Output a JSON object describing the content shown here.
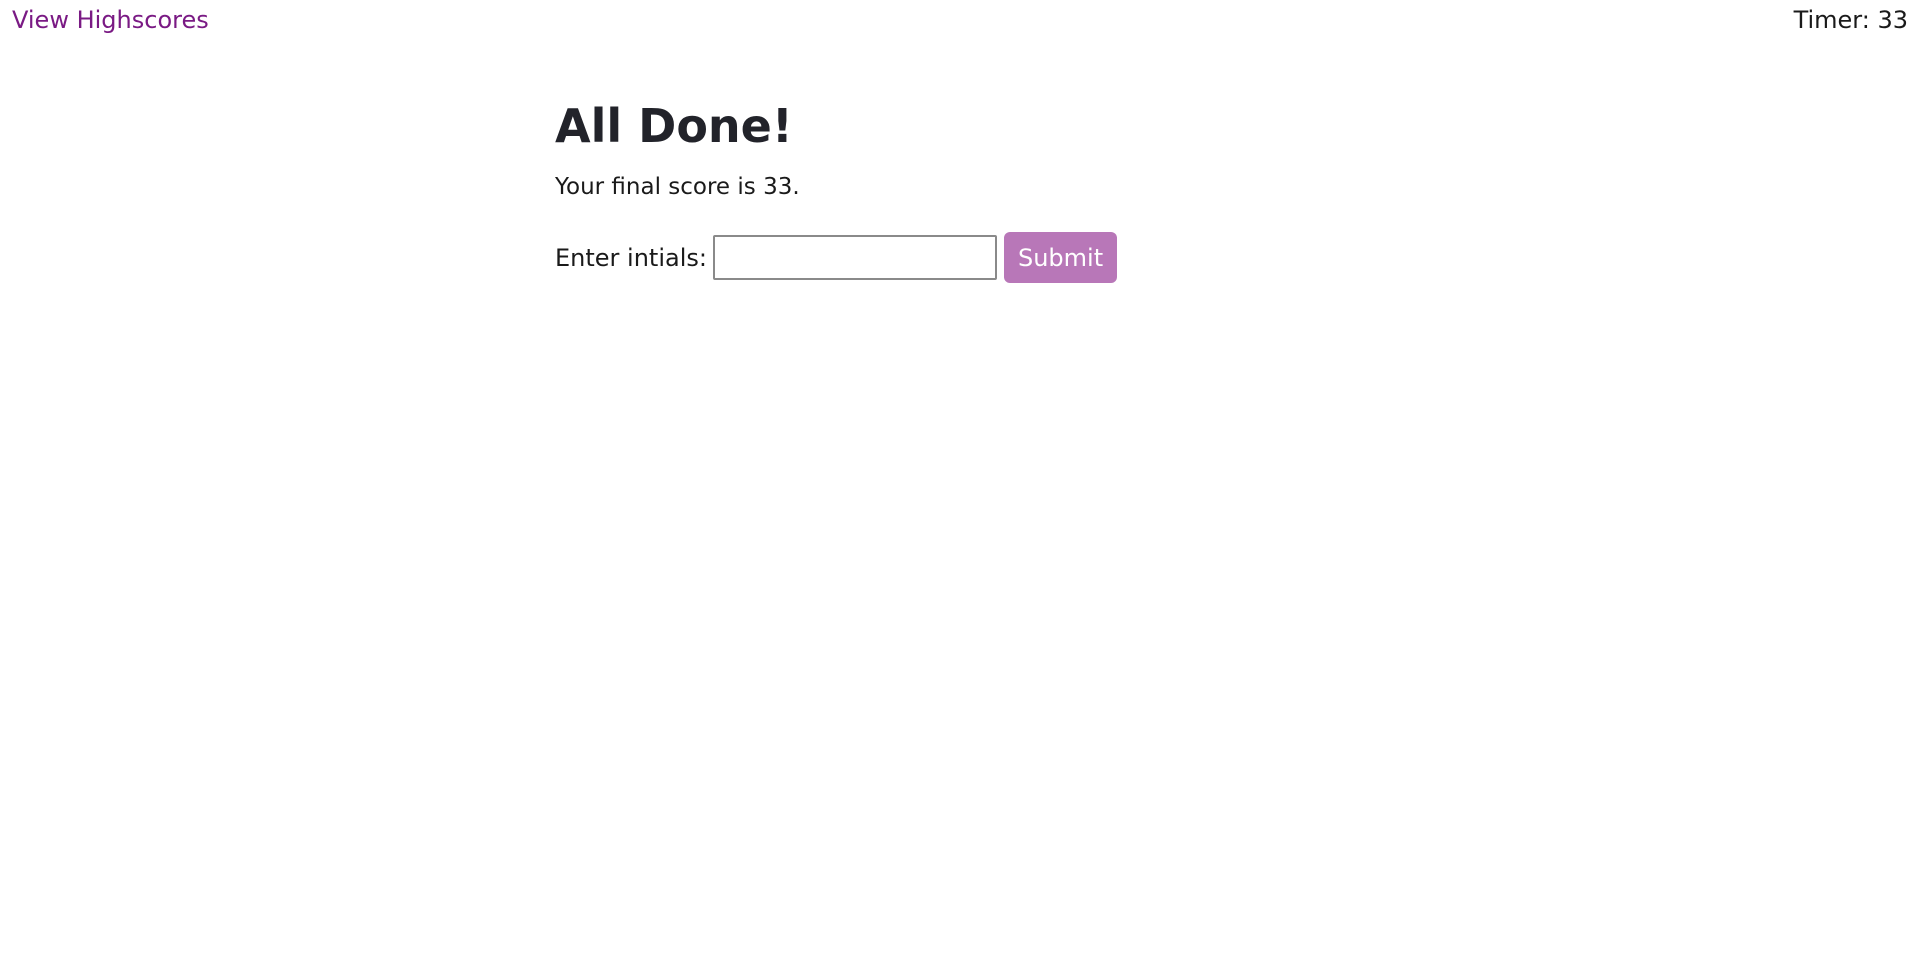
{
  "header": {
    "highscores_link": "View Highscores",
    "timer_label": "Timer: 33"
  },
  "main": {
    "title": "All Done!",
    "final_score_text": "Your final score is 33.",
    "form": {
      "label": "Enter intials:",
      "input_value": "",
      "submit_label": "Submit"
    }
  },
  "colors": {
    "link": "#7a1a84",
    "button": "#b877b8",
    "title": "#22232a"
  }
}
